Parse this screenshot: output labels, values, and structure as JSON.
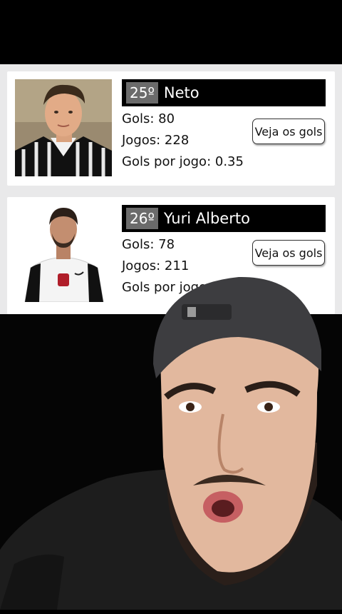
{
  "players": [
    {
      "rank": "25º",
      "name": "Neto",
      "goals": "Gols: 80",
      "games": "Jogos: 228",
      "ratio": "Gols por jogo: 0.35",
      "button": "Veja os gols"
    },
    {
      "rank": "26º",
      "name": "Yuri Alberto",
      "goals": "Gols: 78",
      "games": "Jogos: 211",
      "ratio": "Gols por jogo",
      "button": "Veja os gols"
    }
  ],
  "colors": {
    "panel_bg": "#e9e9ea",
    "rank_bar": "#000000",
    "rank_box": "#6b6b6b"
  }
}
